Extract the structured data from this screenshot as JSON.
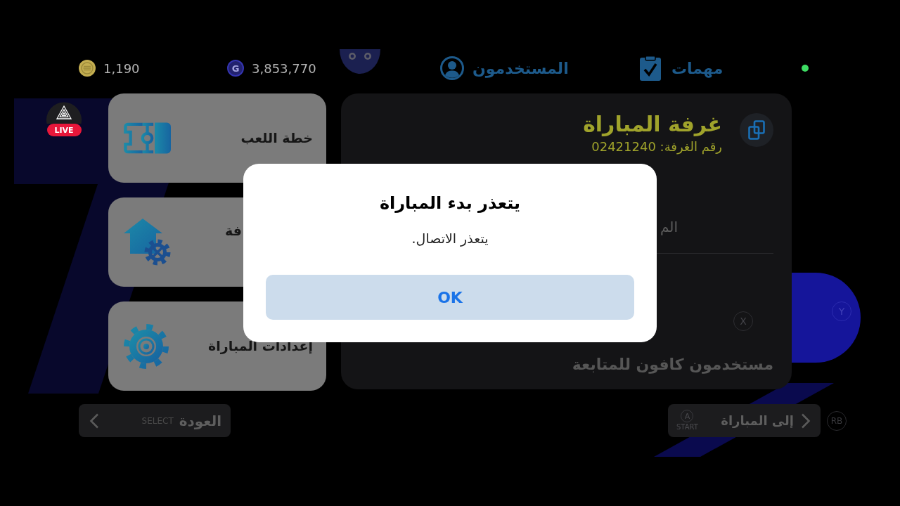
{
  "live_bubble": {
    "label": "LIVE"
  },
  "top_bar": {
    "coins": "1,190",
    "gems_symbol": "G",
    "gems": "3,853,770",
    "tabs": [
      {
        "kind": "tasks",
        "label": "مهمات"
      },
      {
        "kind": "users",
        "label": "المستخدمون"
      }
    ],
    "online": true
  },
  "menu_cards": [
    {
      "kind": "formation",
      "label": "خطة اللعب"
    },
    {
      "kind": "room_settings",
      "label": "فة"
    },
    {
      "kind": "match_settings",
      "label": "إعدادات المباراة"
    }
  ],
  "room_panel": {
    "title": "غرفة المباراة",
    "room_number": "رقم الغرفة: 02421240",
    "field_label": "الم",
    "key_hint": "X",
    "status": "مستخدمون كافون للمتابعة"
  },
  "side_key_hint": "Y",
  "bottom_bar": {
    "buttons": [
      {
        "kind": "forward",
        "label": "إلى المباراة",
        "key": "A",
        "hint": "START"
      },
      {
        "kind": "back",
        "label": "العودة",
        "hint": "SELECT"
      }
    ],
    "shoulder_hint": "RB"
  },
  "dialog": {
    "title": "يتعذر بدء المباراة",
    "message": "يتعذر الاتصال.",
    "button": "OK"
  }
}
